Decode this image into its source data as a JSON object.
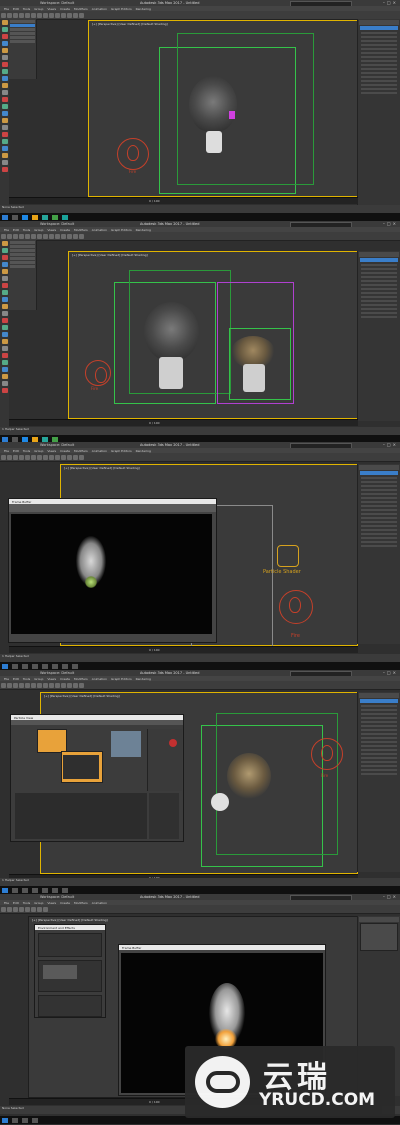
{
  "app": {
    "title": "Autodesk 3ds Max 2017  - Untitled",
    "workspace": "Workspace: Default",
    "search_placeholder": "Type a keyword or phrase"
  },
  "menus": [
    "File",
    "Edit",
    "Tools",
    "Group",
    "Views",
    "Create",
    "Modifiers",
    "Animation",
    "Graph Editors",
    "Rendering",
    "Customize",
    "Scripting",
    "Help"
  ],
  "panels": [
    {
      "viewport_label": "[+] [Perspective] [User Defined] [Default Shading]",
      "fire_label": "Fire",
      "status": "None Selected",
      "time": "0 / 100"
    },
    {
      "viewport_label": "[+] [Perspective] [User Defined] [Default Shading]",
      "fire_label": "Fire",
      "status": "1 Helper Selected",
      "time": "0 / 100"
    },
    {
      "viewport_label": "[+] [Perspective] [User Defined] [Default Shading]",
      "dialog_title": "Frame Buffer",
      "fire_label": "Fire",
      "particle_label": "Particle Shader",
      "status": "1 Helper Selected",
      "time": "0 / 100"
    },
    {
      "viewport_label": "[+] [Perspective] [User Defined] [Default Shading]",
      "dialog_title": "Particle View",
      "fire_label": "Fire",
      "status": "1 Helper Selected",
      "time": "0 / 100"
    },
    {
      "viewport_label": "[+] [Perspective] [User Defined] [Default Shading]",
      "dialog_title": "Environment and Effects",
      "dialog2_title": "Frame Buffer",
      "status": "None Selected",
      "time": "0 / 100"
    }
  ],
  "watermark": {
    "cn": "云瑞",
    "en": "YRUCD.COM"
  },
  "colors": {
    "fire": "#c4402a",
    "bbox_green": "#35c24a",
    "bbox_purple": "#b040d0",
    "active_viewport": "#e0b400",
    "accent_blue": "#3a7ec9"
  }
}
